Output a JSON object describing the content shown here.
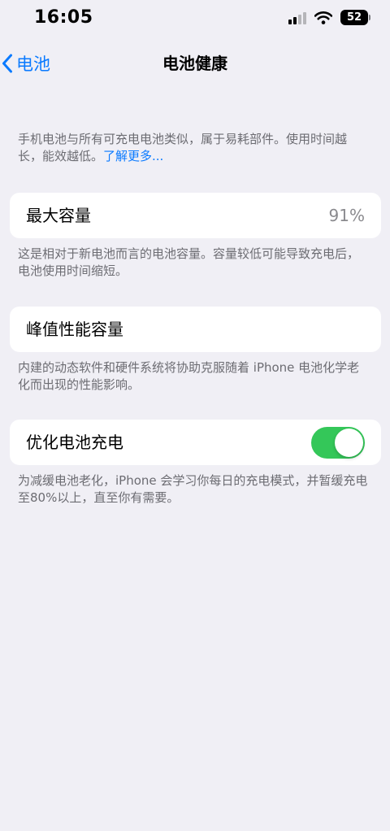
{
  "status_bar": {
    "time": "16:05",
    "battery_level": "52",
    "icons": [
      "signal-icon",
      "wifi-icon",
      "battery-icon"
    ]
  },
  "nav": {
    "back_label": "电池",
    "title": "电池健康"
  },
  "intro": {
    "text": "手机电池与所有可充电电池类似，属于易耗部件。使用时间越长，能效越低。",
    "link": "了解更多..."
  },
  "max_capacity": {
    "label": "最大容量",
    "value": "91%",
    "footnote": "这是相对于新电池而言的电池容量。容量较低可能导致充电后，电池使用时间缩短。"
  },
  "peak_performance": {
    "label": "峰值性能容量",
    "footnote": "内建的动态软件和硬件系统将协助克服随着 iPhone 电池化学老化而出现的性能影响。"
  },
  "optimized_charging": {
    "label": "优化电池充电",
    "enabled": true,
    "footnote": "为减缓电池老化，iPhone 会学习你每日的充电模式，并暂缓充电至80%以上，直至你有需要。"
  },
  "colors": {
    "accent": "#0a7aff",
    "toggle_on": "#34c759",
    "background": "#f0eff5"
  }
}
